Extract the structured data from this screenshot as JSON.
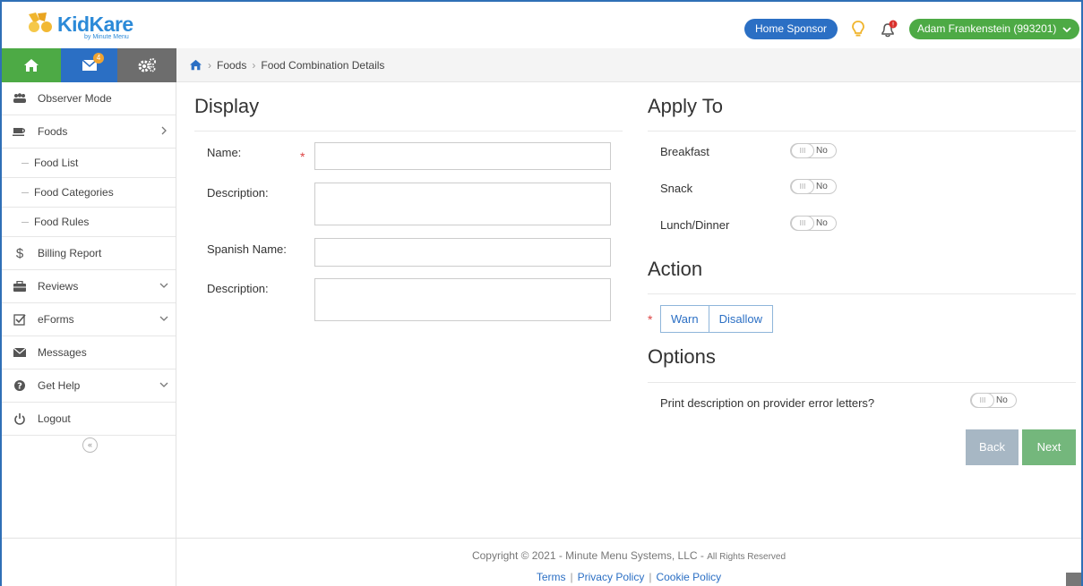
{
  "header": {
    "logo_text": "KidKare",
    "logo_sub": "by Minute Menu",
    "home_sponsor_label": "Home Sponsor",
    "user_label": "Adam Frankenstein (993201)",
    "mail_badge_count": "4"
  },
  "breadcrumb": {
    "items": [
      "Foods",
      "Food Combination Details"
    ]
  },
  "sidebar": {
    "observer_mode": "Observer Mode",
    "foods": "Foods",
    "food_list": "Food List",
    "food_categories": "Food Categories",
    "food_rules": "Food Rules",
    "billing_report": "Billing Report",
    "reviews": "Reviews",
    "eforms": "eForms",
    "messages": "Messages",
    "get_help": "Get Help",
    "logout": "Logout",
    "collapse_glyph": "«"
  },
  "display": {
    "title": "Display",
    "name_label": "Name:",
    "name_value": "",
    "description_label": "Description:",
    "description_value": "",
    "spanish_name_label": "Spanish Name:",
    "spanish_name_value": "",
    "spanish_description_label": "Description:",
    "spanish_description_value": ""
  },
  "apply_to": {
    "title": "Apply To",
    "breakfast_label": "Breakfast",
    "breakfast_value": "No",
    "snack_label": "Snack",
    "snack_value": "No",
    "lunch_label": "Lunch/Dinner",
    "lunch_value": "No"
  },
  "action": {
    "title": "Action",
    "warn_label": "Warn",
    "disallow_label": "Disallow"
  },
  "options": {
    "title": "Options",
    "print_label": "Print description on provider error letters?",
    "print_value": "No"
  },
  "buttons": {
    "back": "Back",
    "next": "Next"
  },
  "footer": {
    "copyright": "Copyright © 2021 - Minute Menu Systems, LLC - ",
    "rights": "All Rights Reserved",
    "terms": "Terms",
    "privacy": "Privacy Policy",
    "cookie": "Cookie Policy"
  },
  "colors": {
    "brand_blue": "#2b6fc4",
    "brand_green": "#4daa45",
    "gear_gray": "#6d6d6d",
    "required_red": "#dd4444"
  },
  "toggle_knob_glyph": "III"
}
